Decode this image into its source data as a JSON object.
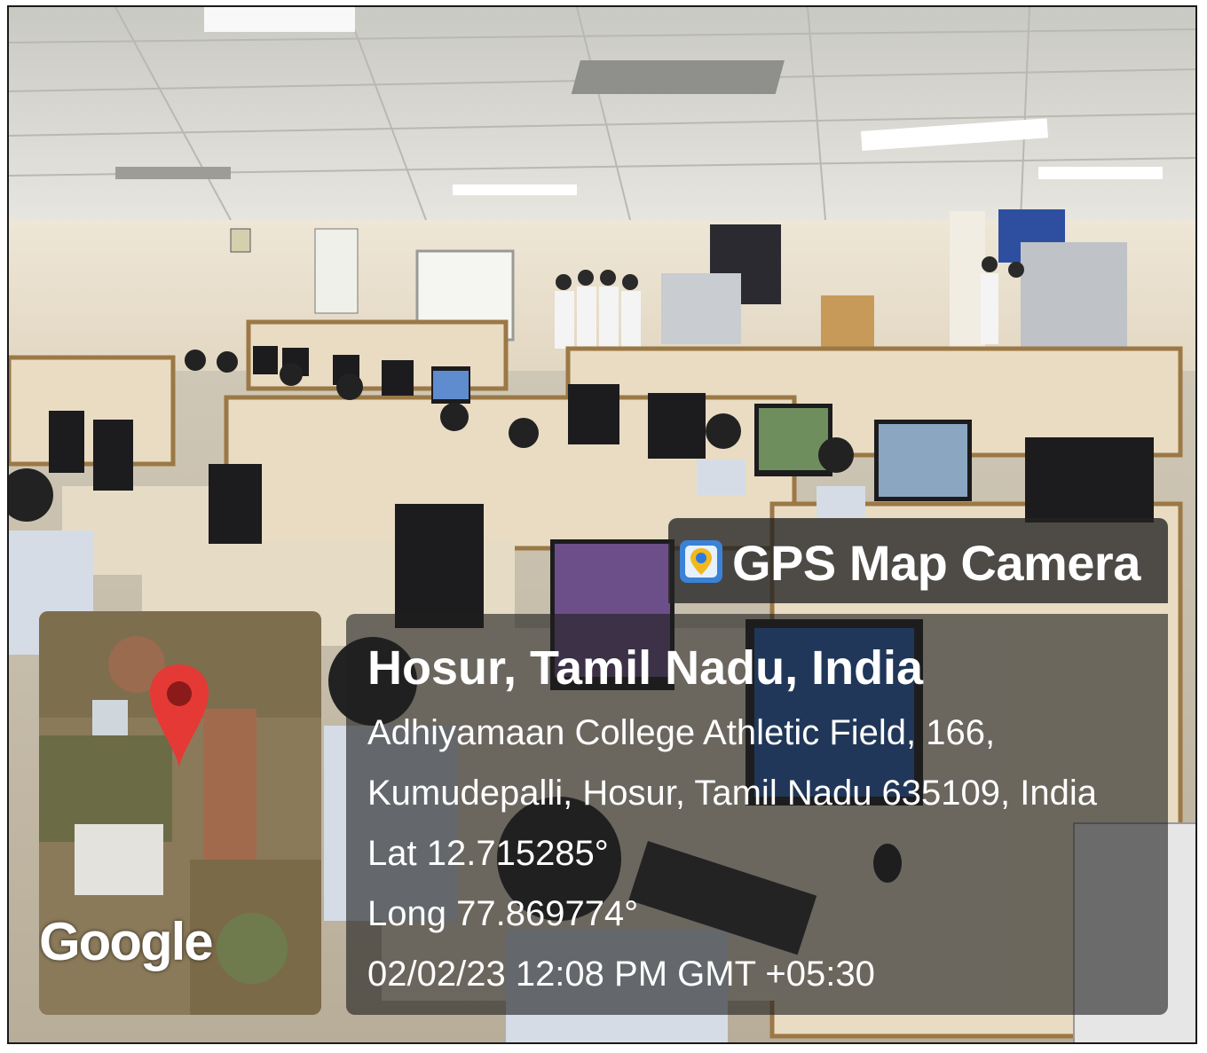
{
  "overlay": {
    "app_name": "GPS Map Camera",
    "app_icon": "map-camera-icon",
    "place_title": "Hosur, Tamil Nadu, India",
    "address_line_1": "Adhiyamaan College Athletic Field, 166,",
    "address_line_2": "Kumudepalli, Hosur, Tamil Nadu 635109, India",
    "latitude": "Lat 12.715285°",
    "longitude": "Long 77.869774°",
    "datetime": "02/02/23 12:08 PM GMT +05:30",
    "map_logo": "Google",
    "pin_icon": "map-pin-icon",
    "colors": {
      "pin": "#e53935",
      "panel": "#1e1e1e",
      "text": "#ffffff"
    }
  }
}
